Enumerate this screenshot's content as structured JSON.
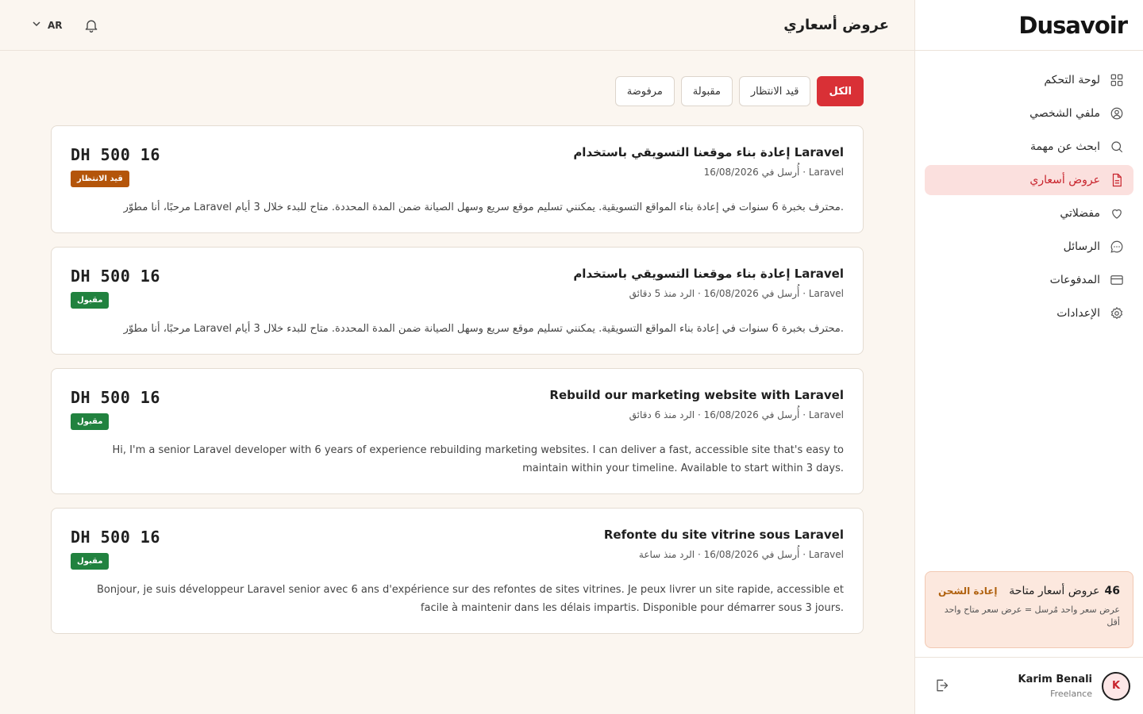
{
  "brand": {
    "name": "Dusavoir"
  },
  "header": {
    "title": "عروض أسعاري",
    "language": "AR"
  },
  "sidebar": {
    "items": [
      {
        "label": "لوحة التحكم",
        "icon": "grid-icon",
        "active": false
      },
      {
        "label": "ملفي الشخصي",
        "icon": "user-circle-icon",
        "active": false
      },
      {
        "label": "ابحث عن مهمة",
        "icon": "search-icon",
        "active": false
      },
      {
        "label": "عروض أسعاري",
        "icon": "document-icon",
        "active": true
      },
      {
        "label": "مفضلاتي",
        "icon": "heart-icon",
        "active": false
      },
      {
        "label": "الرسائل",
        "icon": "chat-icon",
        "active": false
      },
      {
        "label": "المدفوعات",
        "icon": "credit-card-icon",
        "active": false
      },
      {
        "label": "الإعدادات",
        "icon": "gear-icon",
        "active": false
      }
    ]
  },
  "credits": {
    "count": "46",
    "label": "عروض أسعار متاحة",
    "recharge": "إعادة الشحن",
    "note": "عرض سعر واحد مُرسل = عرض سعر متاح واحد أقل"
  },
  "user": {
    "name": "Karim Benali",
    "role": "Freelance",
    "initial": "K"
  },
  "filters": [
    {
      "label": "الكل",
      "active": true
    },
    {
      "label": "قيد الانتظار",
      "active": false
    },
    {
      "label": "مقبولة",
      "active": false
    },
    {
      "label": "مرفوضة",
      "active": false
    }
  ],
  "proposals": [
    {
      "title": "إعادة بناء موقعنا التسويقي باستخدام Laravel",
      "meta": "Laravel · أُرسل في 16/08/2026",
      "amount": "DH 500 16",
      "status": "قيد الانتظار",
      "status_type": "pending",
      "body": "مرحبًا، أنا مطوّر Laravel محترف بخبرة 6 سنوات في إعادة بناء المواقع التسويقية. يمكنني تسليم موقع سريع وسهل الصيانة ضمن المدة المحددة. متاح للبدء خلال 3 أيام."
    },
    {
      "title": "إعادة بناء موقعنا التسويقي باستخدام Laravel",
      "meta": "Laravel · أُرسل في 16/08/2026 · الرد منذ 5 دقائق",
      "amount": "DH 500 16",
      "status": "مقبول",
      "status_type": "accepted",
      "body": "مرحبًا، أنا مطوّر Laravel محترف بخبرة 6 سنوات في إعادة بناء المواقع التسويقية. يمكنني تسليم موقع سريع وسهل الصيانة ضمن المدة المحددة. متاح للبدء خلال 3 أيام."
    },
    {
      "title": "Rebuild our marketing website with Laravel",
      "meta": "Laravel · أُرسل في 16/08/2026 · الرد منذ 6 دقائق",
      "amount": "DH 500 16",
      "status": "مقبول",
      "status_type": "accepted",
      "body": "Hi, I'm a senior Laravel developer with 6 years of experience rebuilding marketing websites. I can deliver a fast, accessible site that's easy to maintain within your timeline. Available to start within 3 days."
    },
    {
      "title": "Refonte du site vitrine sous Laravel",
      "meta": "Laravel · أُرسل في 16/08/2026 · الرد منذ ساعة",
      "amount": "DH 500 16",
      "status": "مقبول",
      "status_type": "accepted",
      "body": "Bonjour, je suis développeur Laravel senior avec 6 ans d'expérience sur des refontes de sites vitrines. Je peux livrer un site rapide, accessible et facile à maintenir dans les délais impartis. Disponible pour démarrer sous 3 jours."
    }
  ]
}
